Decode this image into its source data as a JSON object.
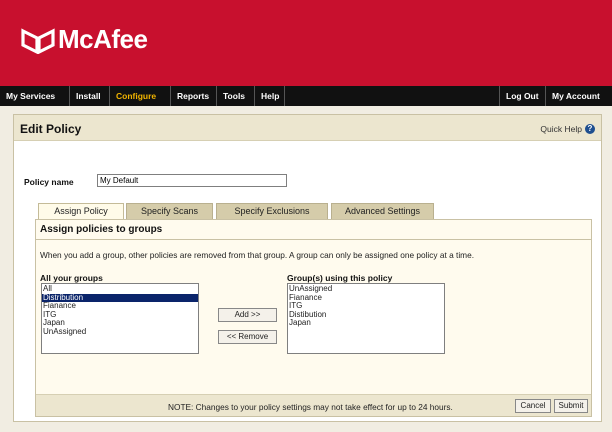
{
  "brand": {
    "name": "McAfee",
    "color": "#c8102e"
  },
  "nav": {
    "items": [
      {
        "label": "My Services",
        "active": false
      },
      {
        "label": "Install",
        "active": false
      },
      {
        "label": "Configure",
        "active": true
      },
      {
        "label": "Reports",
        "active": false
      },
      {
        "label": "Tools",
        "active": false
      },
      {
        "label": "Help",
        "active": false
      }
    ],
    "right": [
      {
        "label": "Log Out"
      },
      {
        "label": "My Account"
      }
    ],
    "active_color": "#f1b400"
  },
  "page": {
    "title": "Edit Policy",
    "quick_help": "Quick Help"
  },
  "policy": {
    "name_label": "Policy name",
    "name_value": "My Default"
  },
  "tabs": [
    {
      "label": "Assign Policy",
      "active": true
    },
    {
      "label": "Specify Scans",
      "active": false
    },
    {
      "label": "Specify Exclusions",
      "active": false
    },
    {
      "label": "Advanced Settings",
      "active": false
    }
  ],
  "assign": {
    "title": "Assign policies to groups",
    "info": "When you add a group, other policies are removed from that group. A group can only be assigned one policy at a time.",
    "all_groups_label": "All your groups",
    "all_groups": [
      "All",
      "Distribution",
      "Fianance",
      "ITG",
      "Japan",
      "UnAssigned"
    ],
    "selected_group": "Distribution",
    "using_label": "Group(s) using this policy",
    "using_groups": [
      "UnAssigned",
      "Fianance",
      "ITG",
      "Distibution",
      "Japan"
    ],
    "add_label": "Add >>",
    "remove_label": "<< Remove"
  },
  "footer": {
    "note": "NOTE: Changes to your policy settings may not take effect for up to 24 hours.",
    "cancel_label": "Cancel",
    "submit_label": "Submit"
  }
}
